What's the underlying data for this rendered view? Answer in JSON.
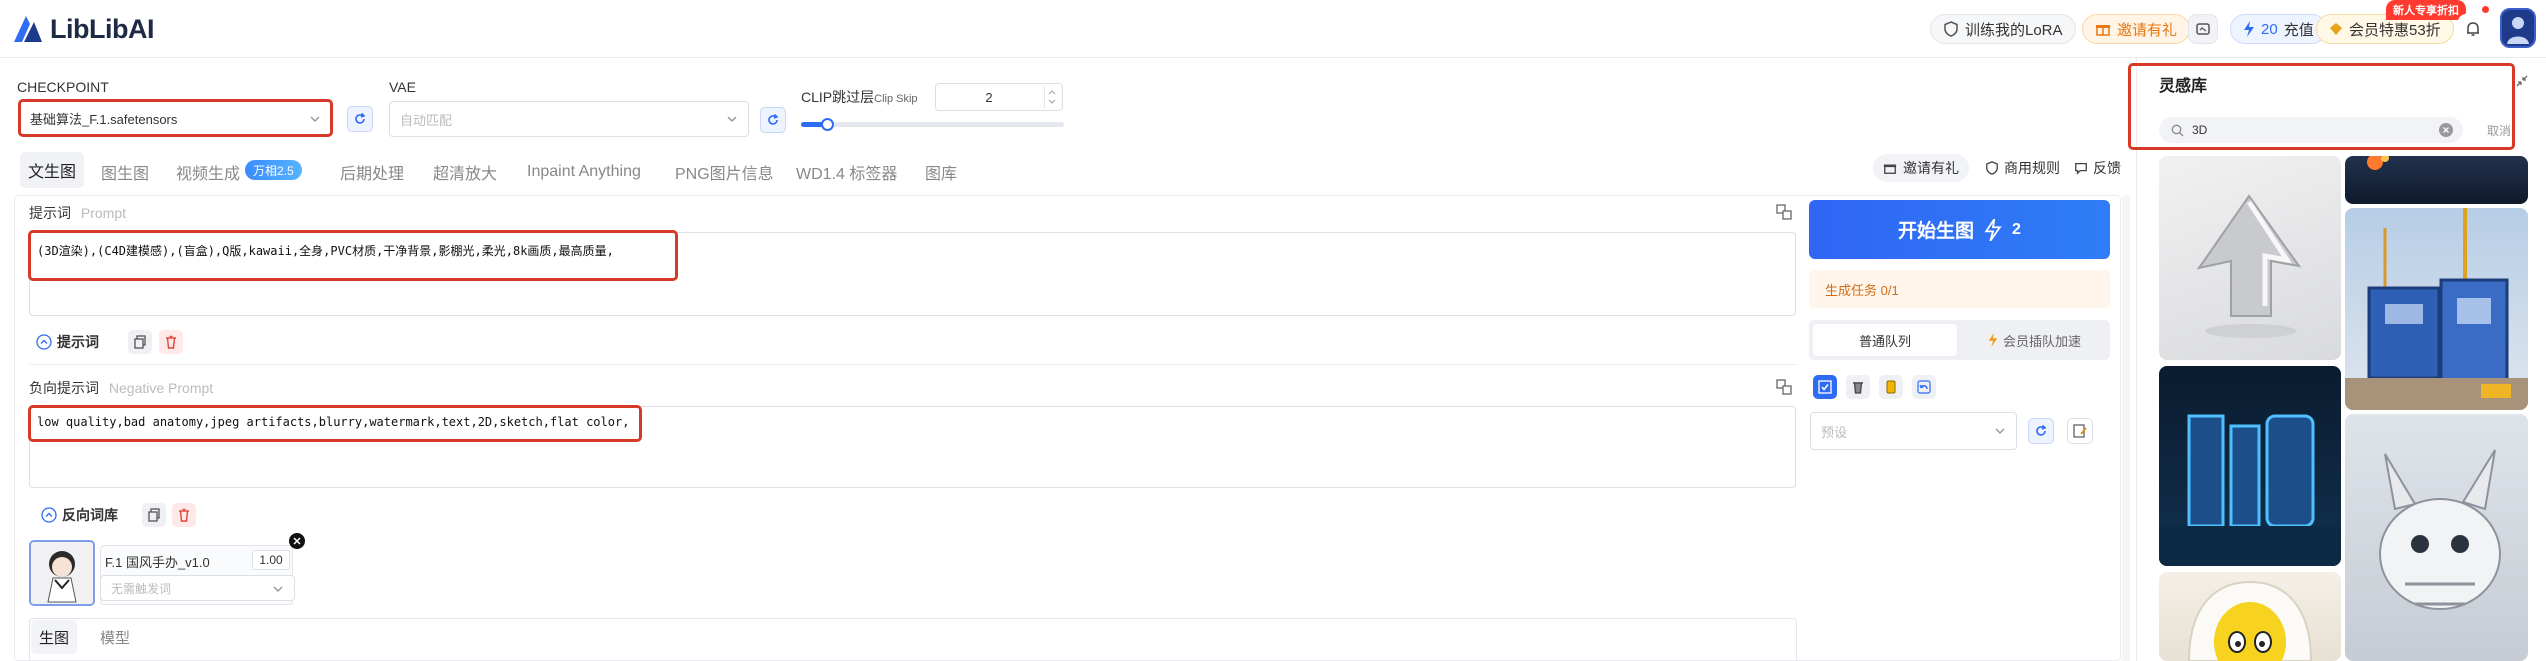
{
  "brand": {
    "name": "LibLibAI"
  },
  "topbar": {
    "train_lora": "训练我的LoRA",
    "invite": "邀请有礼",
    "recharge_count": "20",
    "recharge_label": "充值",
    "member_label": "会员特惠53折",
    "new_user_badge": "新人专享折扣"
  },
  "controls": {
    "checkpoint_label": "CHECKPOINT",
    "checkpoint_value": "基础算法_F.1.safetensors",
    "vae_label": "VAE",
    "vae_placeholder": "自动匹配",
    "clip_label": "CLIP跳过层",
    "clip_label_en": "Clip Skip",
    "clip_value": "2",
    "clip_fraction": 0.1
  },
  "tabs": [
    {
      "label": "文生图"
    },
    {
      "label": "图生图"
    },
    {
      "label": "视频生成"
    },
    {
      "label": "后期处理"
    },
    {
      "label": "超清放大"
    },
    {
      "label": "Inpaint Anything"
    },
    {
      "label": "PNG图片信息"
    },
    {
      "label": "WD1.4 标签器"
    },
    {
      "label": "图库"
    }
  ],
  "video_badge": "万相2.5",
  "right_links": {
    "invite": "邀请有礼",
    "rules": "商用规则",
    "feedback": "反馈"
  },
  "prompt": {
    "label": "提示词",
    "label_en": "Prompt",
    "text": "(3D渲染),(C4D建模感),(盲盒),Q版,kawaii,全身,PVC材质,干净背景,影棚光,柔光,8k画质,最高质量,",
    "lib_button": "提示词"
  },
  "negative": {
    "label": "负向提示词",
    "label_en": "Negative Prompt",
    "text": "low quality,bad anatomy,jpeg artifacts,blurry,watermark,text,2D,sketch,flat color,",
    "lib_button": "反向词库"
  },
  "lora": {
    "name": "F.1 国风手办_v1.0",
    "weight": "1.00",
    "trigger_placeholder": "无需触发词"
  },
  "bottom_tabs": [
    {
      "label": "生图"
    },
    {
      "label": "模型"
    }
  ],
  "generate": {
    "label": "开始生图",
    "cost": "2",
    "task_status": "生成任务 0/1",
    "queue_normal": "普通队列",
    "queue_vip": "会员插队加速",
    "preset_placeholder": "预设"
  },
  "inspiration": {
    "title": "灵感库",
    "search_value": "3D",
    "cancel": "取消"
  },
  "colors": {
    "accent": "#2f6cf4",
    "highlight_box": "#d63a26",
    "member_gold": "#e8a317"
  }
}
